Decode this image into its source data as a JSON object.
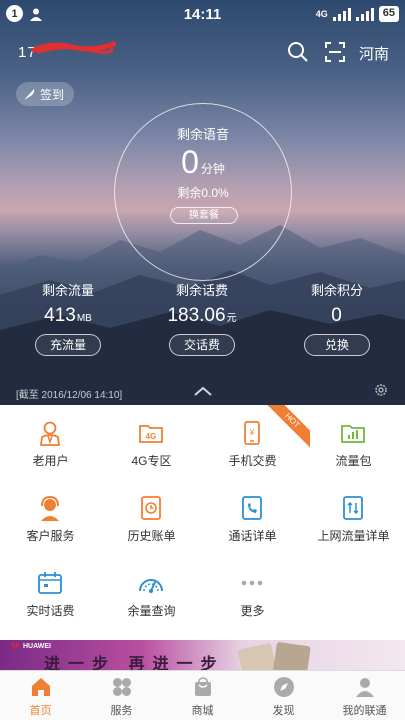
{
  "statusbar": {
    "notification_count": "1",
    "time": "14:11",
    "network": "4G",
    "battery": "65"
  },
  "header": {
    "phone_number": "17",
    "region": "河南"
  },
  "checkin_label": "签到",
  "voice": {
    "title": "剩余语音",
    "value": "0",
    "unit": "分钟",
    "percent_text": "剩余0.0%",
    "change_plan_label": "换套餐"
  },
  "stats": [
    {
      "label": "剩余流量",
      "value": "413",
      "unit": "MB",
      "button": "充流量"
    },
    {
      "label": "剩余话费",
      "value": "183.06",
      "unit": "元",
      "button": "交话费"
    },
    {
      "label": "剩余积分",
      "value": "0",
      "unit": "",
      "button": "兑换"
    }
  ],
  "as_of": "[截至 2016/12/06 14:10]",
  "grid": [
    {
      "label": "老用户",
      "icon": "user-icon"
    },
    {
      "label": "4G专区",
      "icon": "4g-folder-icon"
    },
    {
      "label": "手机交费",
      "icon": "phone-pay-icon",
      "badge": "HOT"
    },
    {
      "label": "流量包",
      "icon": "data-package-icon"
    },
    {
      "label": "客户服务",
      "icon": "customer-service-icon"
    },
    {
      "label": "历史账单",
      "icon": "history-bill-icon"
    },
    {
      "label": "通话详单",
      "icon": "call-detail-icon"
    },
    {
      "label": "上网流量详单",
      "icon": "data-detail-icon"
    },
    {
      "label": "实时话费",
      "icon": "realtime-fee-icon"
    },
    {
      "label": "余量查询",
      "icon": "balance-gauge-icon"
    },
    {
      "label": "更多",
      "icon": "more-icon"
    }
  ],
  "banner": {
    "brand": "HUAWEI",
    "text": "进一步 再进一步"
  },
  "tabs": [
    {
      "label": "首页",
      "icon": "home-icon",
      "active": true
    },
    {
      "label": "服务",
      "icon": "services-icon"
    },
    {
      "label": "商城",
      "icon": "shop-bag-icon"
    },
    {
      "label": "发现",
      "icon": "compass-icon"
    },
    {
      "label": "我的联通",
      "icon": "profile-icon"
    }
  ],
  "colors": {
    "accent": "#f07f33",
    "hot_badge": "#f07f33",
    "icon_blue": "#2c8fd6",
    "icon_green": "#6fba3c",
    "icon_gray": "#aaaaaa"
  }
}
